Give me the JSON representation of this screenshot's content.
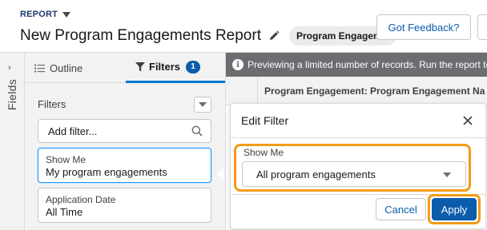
{
  "header": {
    "report_label": "REPORT",
    "title": "New Program Engagements Report",
    "report_type_pill": "Program Engagem...",
    "feedback_button": "Got Feedback?"
  },
  "rail": {
    "label": "Fields",
    "expand_glyph": "›"
  },
  "panel": {
    "tabs": [
      {
        "label": "Outline",
        "icon": "list-icon"
      },
      {
        "label": "Filters",
        "icon": "funnel-icon",
        "badge": "1"
      }
    ],
    "filters_heading": "Filters",
    "add_filter_placeholder": "Add filter...",
    "filters": [
      {
        "label": "Show Me",
        "value": "My program engagements"
      },
      {
        "label": "Application Date",
        "value": "All Time"
      }
    ]
  },
  "preview": {
    "info_text": "Previewing a limited number of records. Run the report to",
    "column_header": "Program Engagement: Program Engagement Na"
  },
  "edit_filter": {
    "title": "Edit Filter",
    "field_label": "Show Me",
    "selected_value": "All program engagements",
    "cancel_label": "Cancel",
    "apply_label": "Apply"
  },
  "colors": {
    "brand_blue": "#0b5cab",
    "highlight_orange": "#f29b15",
    "info_bar": "#6b6d70"
  }
}
